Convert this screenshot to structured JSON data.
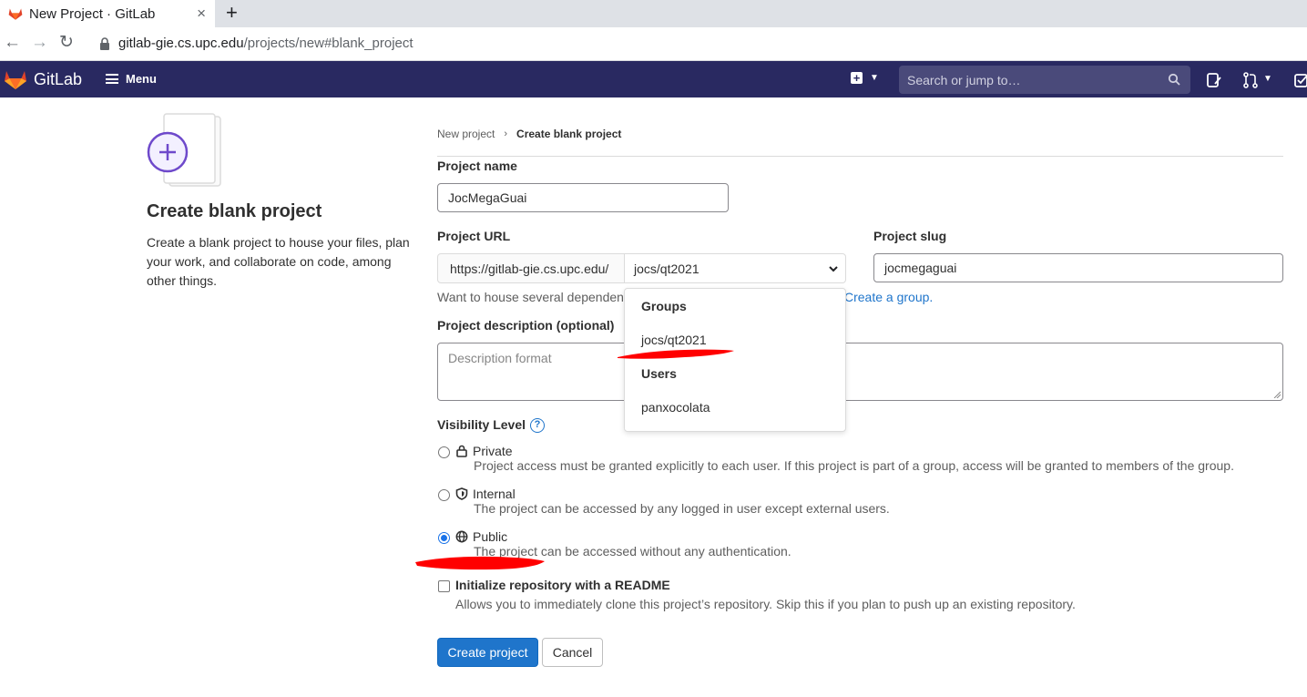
{
  "browser": {
    "tab_title": "New Project · GitLab",
    "tab_close": "×",
    "new_tab": "+",
    "url_host": "gitlab-gie.cs.upc.edu",
    "url_path": "/projects/new#blank_project",
    "back": "←",
    "forward": "→",
    "reload": "↻"
  },
  "topnav": {
    "brand": "GitLab",
    "menu_label": "Menu",
    "search_placeholder": "Search or jump to…",
    "accent": "#292961"
  },
  "sidebar": {
    "title": "Create blank project",
    "description": "Create a blank project to house your files, plan your work, and collaborate on code, among other things."
  },
  "breadcrumb": {
    "parent": "New project",
    "separator": "›",
    "current": "Create blank project"
  },
  "form": {
    "project_name_label": "Project name",
    "project_name_value": "JocMegaGuai",
    "project_url_label": "Project URL",
    "url_prefix": "https://gitlab-gie.cs.upc.edu/",
    "namespace_value": "jocs/qt2021",
    "project_slug_label": "Project slug",
    "project_slug_value": "jocmegaguai",
    "help_text": "Want to house several dependent",
    "help_link": "Create a group.",
    "description_label": "Project description (optional)",
    "description_placeholder": "Description format",
    "visibility_label": "Visibility Level",
    "visibility_help": "?",
    "visibility_options": [
      {
        "name": "Private",
        "icon": "lock-icon",
        "selected": false,
        "description": "Project access must be granted explicitly to each user. If this project is part of a group, access will be granted to members of the group."
      },
      {
        "name": "Internal",
        "icon": "shield-icon",
        "selected": false,
        "description": "The project can be accessed by any logged in user except external users."
      },
      {
        "name": "Public",
        "icon": "globe-icon",
        "selected": true,
        "description": "The project can be accessed without any authentication."
      }
    ],
    "readme_label": "Initialize repository with a README",
    "readme_checked": false,
    "readme_description": "Allows you to immediately clone this project’s repository. Skip this if you plan to push up an existing repository.",
    "submit_label": "Create project",
    "cancel_label": "Cancel",
    "primary_color": "#1f75cb"
  },
  "namespace_dropdown": {
    "groups_header": "Groups",
    "groups": [
      "jocs/qt2021"
    ],
    "users_header": "Users",
    "users": [
      "panxocolata"
    ]
  },
  "annotations": {
    "marker_color": "#ff0000"
  }
}
